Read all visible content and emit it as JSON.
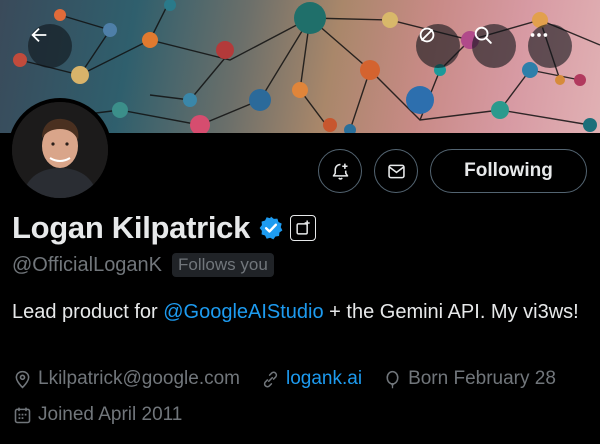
{
  "profile": {
    "display_name": "Logan Kilpatrick",
    "handle": "@OfficialLoganK",
    "follows_you": "Follows you",
    "bio_prefix": "Lead product for ",
    "bio_mention": "@GoogleAIStudio",
    "bio_suffix": " + the Gemini API. My vi3ws!",
    "email": "Lkilpatrick@google.com",
    "website": "logank.ai",
    "birthday": "Born February 28",
    "joined": "Joined April 2011"
  },
  "actions": {
    "following_label": "Following"
  },
  "icons": {
    "back": "arrow-left-icon",
    "grok": "grok-icon",
    "search": "search-icon",
    "more": "more-icon",
    "notify": "bell-plus-icon",
    "message": "envelope-icon",
    "verified": "verified-badge-icon",
    "affiliate": "affiliate-icon",
    "location": "location-pin-icon",
    "link": "link-icon",
    "birthday": "balloon-icon",
    "calendar": "calendar-icon"
  },
  "colors": {
    "accent": "#1d9bf0",
    "muted": "#71767b",
    "text": "#e7e9ea",
    "background": "#000000"
  }
}
